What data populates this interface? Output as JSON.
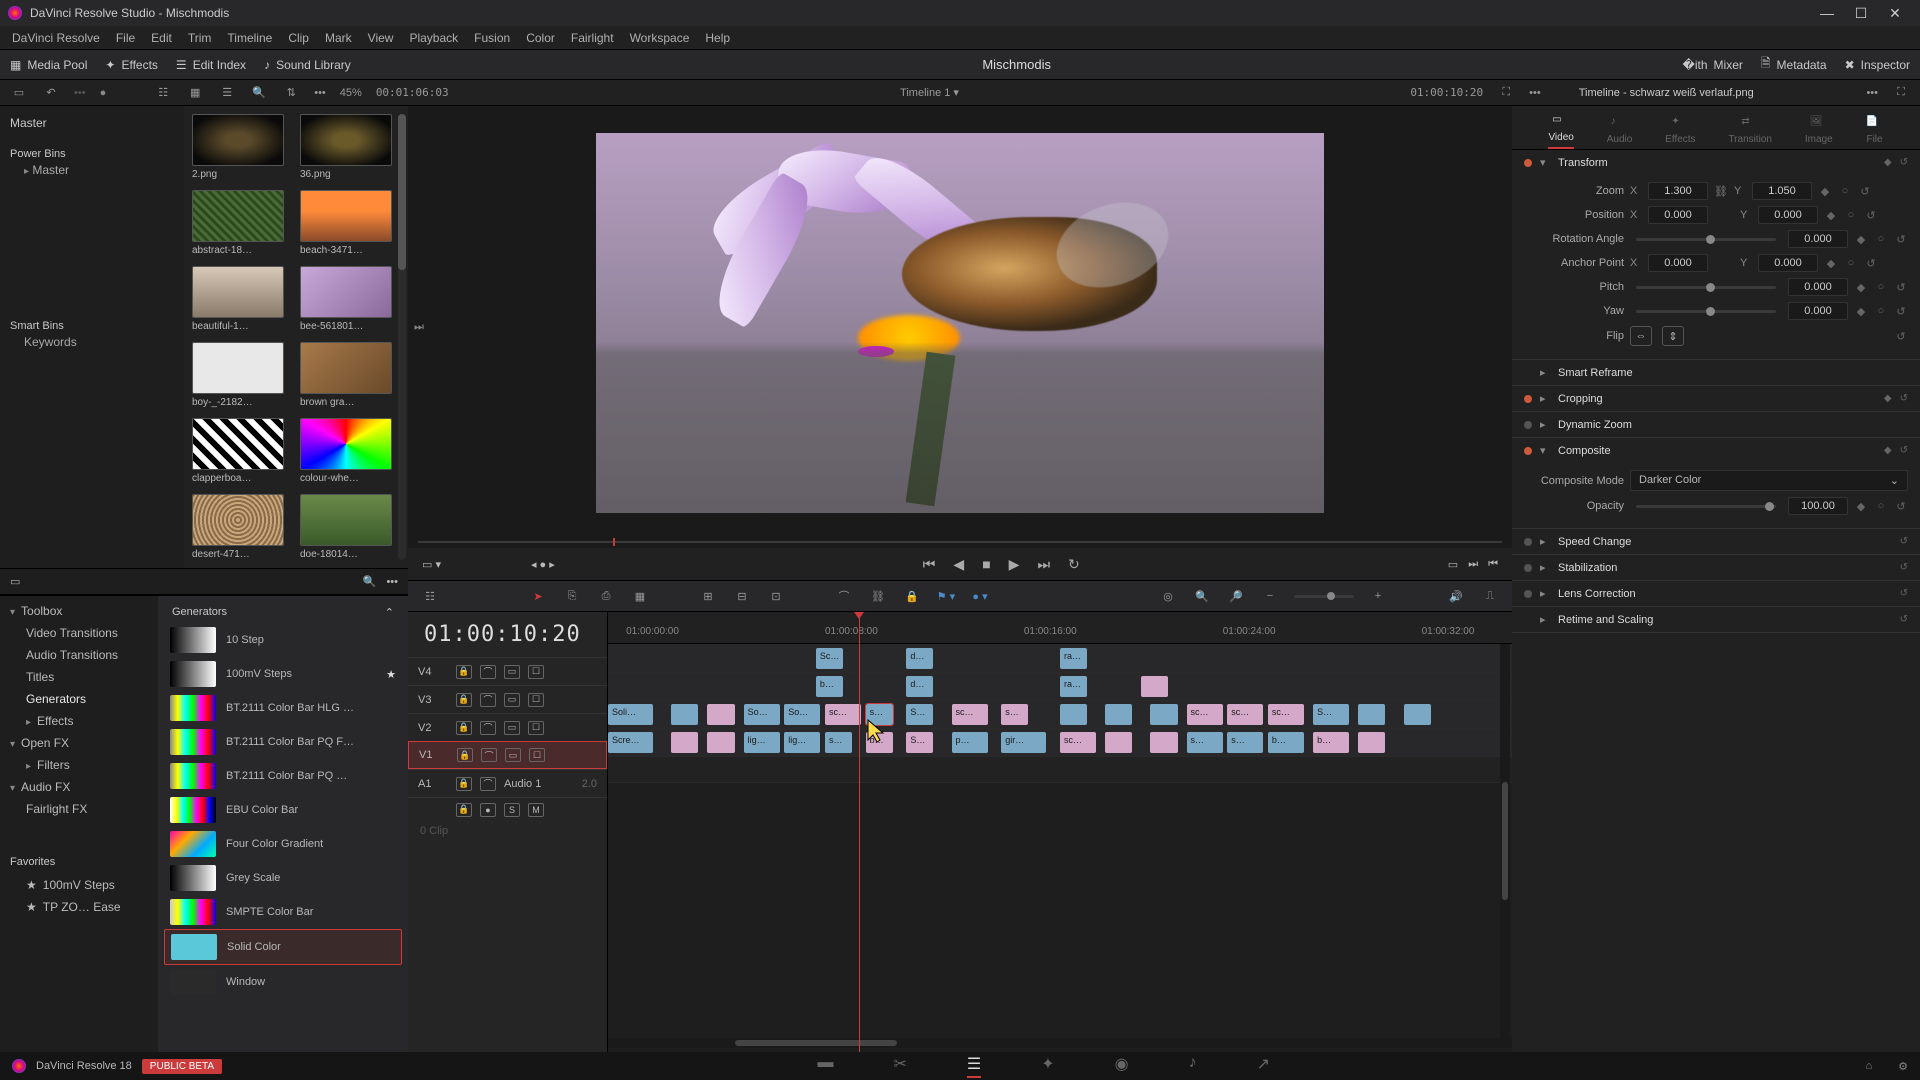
{
  "titlebar": {
    "app": "DaVinci Resolve Studio",
    "project": "Mischmodis"
  },
  "menubar": [
    "DaVinci Resolve",
    "File",
    "Edit",
    "Trim",
    "Timeline",
    "Clip",
    "Mark",
    "View",
    "Playback",
    "Fusion",
    "Color",
    "Fairlight",
    "Workspace",
    "Help"
  ],
  "toolbar": {
    "media_pool": "Media Pool",
    "effects": "Effects",
    "edit_index": "Edit Index",
    "sound_library": "Sound Library",
    "title": "Mischmodis",
    "mixer": "Mixer",
    "metadata": "Metadata",
    "inspector": "Inspector"
  },
  "subbar": {
    "zoom": "45%",
    "tc_left": "00:01:06:03",
    "timeline_name": "Timeline 1",
    "tc_right": "01:00:10:20",
    "selection": "Timeline - schwarz weiß verlauf.png"
  },
  "mediapool": {
    "master": "Master",
    "power_bins": "Power Bins",
    "power_master": "Master",
    "smart_bins": "Smart Bins",
    "keywords": "Keywords",
    "thumbs": [
      {
        "label": "2.png",
        "bg": "radial-gradient(ellipse,#5a4a2a 20%,#0a0a0a 80%)"
      },
      {
        "label": "36.png",
        "bg": "radial-gradient(ellipse,#6a5a2a 20%,#0a0a0a 80%)"
      },
      {
        "label": "abstract-18…",
        "bg": "repeating-linear-gradient(45deg,#4a6a3a,#4a6a3a 3px,#2a4a1a 3px,#2a4a1a 6px)"
      },
      {
        "label": "beach-3471…",
        "bg": "linear-gradient(180deg,#ff8a3a 40%,#8a4a2a 100%)"
      },
      {
        "label": "beautiful-1…",
        "bg": "linear-gradient(180deg,#d8c8b8,#8a7a6a)"
      },
      {
        "label": "bee-561801…",
        "bg": "linear-gradient(135deg,#c8a8d8,#8a6a9a)"
      },
      {
        "label": "boy-_-2182…",
        "bg": "#e8e8e8"
      },
      {
        "label": "brown gra…",
        "bg": "linear-gradient(135deg,#a87a4a,#6a4a2a)"
      },
      {
        "label": "clapperboa…",
        "bg": "repeating-linear-gradient(45deg,#fff,#fff 6px,#000 6px,#000 12px)"
      },
      {
        "label": "colour-whe…",
        "bg": "conic-gradient(red,yellow,lime,cyan,blue,magenta,red)"
      },
      {
        "label": "desert-471…",
        "bg": "repeating-radial-gradient(circle,#c8a878,#c8a878 2px,#8a6a4a 2px,#8a6a4a 4px)"
      },
      {
        "label": "doe-18014…",
        "bg": "linear-gradient(180deg,#6a8a4a,#3a5a2a)"
      }
    ]
  },
  "fx": {
    "toolbox": "Toolbox",
    "vt": "Video Transitions",
    "at": "Audio Transitions",
    "titles": "Titles",
    "generators": "Generators",
    "effects": "Effects",
    "openfx": "Open FX",
    "filters": "Filters",
    "audiofx": "Audio FX",
    "fairlight": "Fairlight FX",
    "favorites": "Favorites",
    "fav1": "100mV Steps",
    "fav2": "TP ZO… Ease",
    "list_title": "Generators",
    "items": [
      {
        "name": "10 Step",
        "sw": "linear-gradient(90deg,#000,#fff)"
      },
      {
        "name": "100mV Steps",
        "sw": "linear-gradient(90deg,#000,#fff)",
        "fav": true
      },
      {
        "name": "BT.2111 Color Bar HLG …",
        "sw": "linear-gradient(90deg,#888,#ff0,#0ff,#0f0,#f0f,#f00,#00f)"
      },
      {
        "name": "BT.2111 Color Bar PQ F…",
        "sw": "linear-gradient(90deg,#888,#ff0,#0ff,#0f0,#f0f,#f00,#00f)"
      },
      {
        "name": "BT.2111 Color Bar PQ …",
        "sw": "linear-gradient(90deg,#888,#ff0,#0ff,#0f0,#f0f,#f00,#00f)"
      },
      {
        "name": "EBU Color Bar",
        "sw": "linear-gradient(90deg,#fff,#ff0,#0ff,#0f0,#f0f,#f00,#00f,#000)"
      },
      {
        "name": "Four Color Gradient",
        "sw": "linear-gradient(135deg,#f0a,#fa0,#0af,#0fa)"
      },
      {
        "name": "Grey Scale",
        "sw": "linear-gradient(90deg,#000,#fff)"
      },
      {
        "name": "SMPTE Color Bar",
        "sw": "linear-gradient(90deg,#ccc,#ff0,#0ff,#0f0,#f0f,#f00,#00f)"
      },
      {
        "name": "Solid Color",
        "sw": "#5ac8d8",
        "sel": true
      },
      {
        "name": "Window",
        "sw": "#2a2a2a"
      }
    ]
  },
  "timeline": {
    "tc": "01:00:10:20",
    "ruler": [
      "01:00:00:00",
      "01:00:08:00",
      "01:00:16:00",
      "01:00:24:00",
      "01:00:32:00"
    ],
    "tracks": [
      "V4",
      "V3",
      "V2",
      "V1"
    ],
    "audio": "A1",
    "audio_name": "Audio 1",
    "audio_level": "2.0",
    "clips_hint": "0 Clip",
    "v4": [
      {
        "l": 23,
        "w": 3,
        "t": "Sc…",
        "c": "blue"
      },
      {
        "l": 33,
        "w": 3,
        "t": "d…",
        "c": "blue"
      },
      {
        "l": 50,
        "w": 3,
        "t": "ra…",
        "c": "blue"
      }
    ],
    "v3": [
      {
        "l": 23,
        "w": 3,
        "t": "b…",
        "c": "blue"
      },
      {
        "l": 33,
        "w": 3,
        "t": "d…",
        "c": "blue"
      },
      {
        "l": 50,
        "w": 3,
        "t": "ra…",
        "c": "blue"
      },
      {
        "l": 59,
        "w": 3,
        "t": "",
        "c": "pink"
      }
    ],
    "v2": [
      {
        "l": 0,
        "w": 5,
        "t": "Soli…",
        "c": "blue"
      },
      {
        "l": 7,
        "w": 3,
        "t": "",
        "c": "blue"
      },
      {
        "l": 11,
        "w": 3,
        "t": "",
        "c": "pink"
      },
      {
        "l": 15,
        "w": 4,
        "t": "So…",
        "c": "blue"
      },
      {
        "l": 19.5,
        "w": 4,
        "t": "So…",
        "c": "blue"
      },
      {
        "l": 24,
        "w": 4,
        "t": "sc…",
        "c": "pink"
      },
      {
        "l": 28.5,
        "w": 3,
        "t": "s…",
        "c": "blue",
        "sel": true
      },
      {
        "l": 33,
        "w": 3,
        "t": "S…",
        "c": "blue"
      },
      {
        "l": 38,
        "w": 4,
        "t": "sc…",
        "c": "pink"
      },
      {
        "l": 43.5,
        "w": 3,
        "t": "s…",
        "c": "pink"
      },
      {
        "l": 50,
        "w": 3,
        "t": "",
        "c": "blue"
      },
      {
        "l": 55,
        "w": 3,
        "t": "",
        "c": "blue"
      },
      {
        "l": 60,
        "w": 3,
        "t": "",
        "c": "blue"
      },
      {
        "l": 64,
        "w": 4,
        "t": "sc…",
        "c": "pink"
      },
      {
        "l": 68.5,
        "w": 4,
        "t": "sc…",
        "c": "pink"
      },
      {
        "l": 73,
        "w": 4,
        "t": "sc…",
        "c": "pink"
      },
      {
        "l": 78,
        "w": 4,
        "t": "S…",
        "c": "blue"
      },
      {
        "l": 83,
        "w": 3,
        "t": "",
        "c": "blue"
      },
      {
        "l": 88,
        "w": 3,
        "t": "",
        "c": "blue"
      }
    ],
    "v1": [
      {
        "l": 0,
        "w": 5,
        "t": "Scre…",
        "c": "blue"
      },
      {
        "l": 7,
        "w": 3,
        "t": "",
        "c": "pink"
      },
      {
        "l": 11,
        "w": 3,
        "t": "",
        "c": "pink"
      },
      {
        "l": 15,
        "w": 4,
        "t": "lig…",
        "c": "blue"
      },
      {
        "l": 19.5,
        "w": 4,
        "t": "lig…",
        "c": "blue"
      },
      {
        "l": 24,
        "w": 3,
        "t": "s…",
        "c": "blue"
      },
      {
        "l": 28.5,
        "w": 3,
        "t": "b…",
        "c": "pink"
      },
      {
        "l": 33,
        "w": 3,
        "t": "S…",
        "c": "pink"
      },
      {
        "l": 38,
        "w": 4,
        "t": "p…",
        "c": "blue"
      },
      {
        "l": 43.5,
        "w": 5,
        "t": "gir…",
        "c": "blue"
      },
      {
        "l": 50,
        "w": 4,
        "t": "sc…",
        "c": "pink"
      },
      {
        "l": 55,
        "w": 3,
        "t": "",
        "c": "pink"
      },
      {
        "l": 60,
        "w": 3,
        "t": "",
        "c": "pink"
      },
      {
        "l": 64,
        "w": 4,
        "t": "s…",
        "c": "blue"
      },
      {
        "l": 68.5,
        "w": 4,
        "t": "s…",
        "c": "blue"
      },
      {
        "l": 73,
        "w": 4,
        "t": "b…",
        "c": "blue"
      },
      {
        "l": 78,
        "w": 4,
        "t": "b…",
        "c": "pink"
      },
      {
        "l": 83,
        "w": 3,
        "t": "",
        "c": "pink"
      }
    ]
  },
  "inspector": {
    "tabs": [
      "Video",
      "Audio",
      "Effects",
      "Transition",
      "Image",
      "File"
    ],
    "transform": "Transform",
    "zoom": "Zoom",
    "zoom_x": "1.300",
    "zoom_y": "1.050",
    "position": "Position",
    "pos_x": "0.000",
    "pos_y": "0.000",
    "rotation": "Rotation Angle",
    "rot_v": "0.000",
    "anchor": "Anchor Point",
    "anc_x": "0.000",
    "anc_y": "0.000",
    "pitch": "Pitch",
    "pitch_v": "0.000",
    "yaw": "Yaw",
    "yaw_v": "0.000",
    "flip": "Flip",
    "smart_reframe": "Smart Reframe",
    "cropping": "Cropping",
    "dynamic_zoom": "Dynamic Zoom",
    "composite": "Composite",
    "comp_mode_lbl": "Composite Mode",
    "comp_mode": "Darker Color",
    "opacity": "Opacity",
    "opacity_v": "100.00",
    "speed": "Speed Change",
    "stab": "Stabilization",
    "lens": "Lens Correction",
    "retime": "Retime and Scaling"
  },
  "bottom": {
    "app": "DaVinci Resolve 18",
    "beta": "PUBLIC BETA"
  }
}
